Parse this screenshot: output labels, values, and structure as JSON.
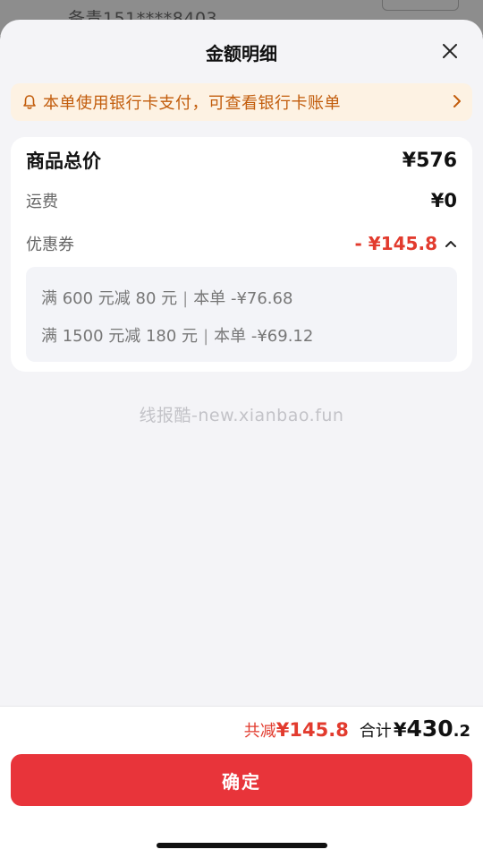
{
  "background": {
    "text": "备青151****8403"
  },
  "header": {
    "title": "金额明细"
  },
  "notice": {
    "text": "本单使用银行卡支付，可查看银行卡账单"
  },
  "summary": {
    "total_label": "商品总价",
    "total_value": "¥576",
    "shipping_label": "运费",
    "shipping_value": "¥0",
    "coupon_label": "优惠券",
    "coupon_value": "- ¥145.8"
  },
  "coupons": [
    {
      "rule": "满 600 元减 80 元",
      "detail": "本单 -¥76.68"
    },
    {
      "rule": "满 1500 元减 180 元",
      "detail": "本单 -¥69.12"
    }
  ],
  "watermark": "线报酷-new.xianbao.fun",
  "footer": {
    "reduce_label": "共减",
    "reduce_value": "¥145.8",
    "total_label": "合计",
    "total_yen": "¥",
    "total_int": "430",
    "total_dec": ".2",
    "confirm_label": "确定"
  },
  "colors": {
    "accent_red": "#e8343a",
    "notice_bg": "#fdf2e3",
    "notice_text": "#c25c0b"
  }
}
